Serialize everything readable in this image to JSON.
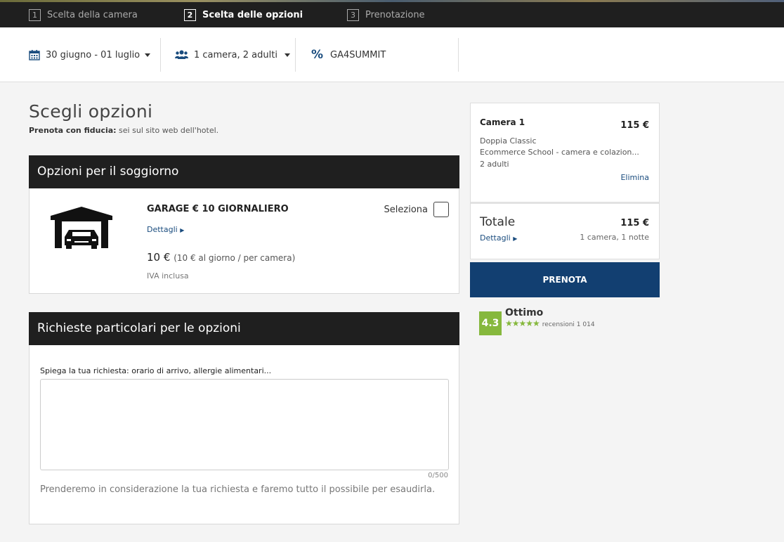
{
  "steps": [
    {
      "num": "1",
      "label": "Scelta della camera"
    },
    {
      "num": "2",
      "label": "Scelta delle opzioni"
    },
    {
      "num": "3",
      "label": "Prenotazione"
    }
  ],
  "filters": {
    "dates": "30 giugno - 01 luglio",
    "guests": "1 camera, 2 adulti",
    "promo_symbol": "%",
    "promo_code": "GA4SUMMIT"
  },
  "main": {
    "title": "Scegli opzioni",
    "trust_bold": "Prenota con fiducia:",
    "trust_text": " sei sul sito web dell'hotel."
  },
  "options_section": {
    "header": "Opzioni per il soggiorno",
    "item": {
      "title": "GARAGE € 10 GIORNALIERO",
      "details": "Dettagli",
      "price": "10 €",
      "price_note": "(10 € al giorno / per camera)",
      "vat": "IVA inclusa",
      "select_label": "Seleziona"
    }
  },
  "requests_section": {
    "header": "Richieste particolari per le opzioni",
    "label": "Spiega la tua richiesta: orario di arrivo, allergie alimentari...",
    "value": "",
    "counter": "0/500",
    "note": "Prenderemo in considerazione la tua richiesta e faremo tutto il possibile per esaudirla."
  },
  "summary": {
    "room": {
      "title": "Camera 1",
      "price": "115 €",
      "type": "Doppia Classic",
      "rate": "Ecommerce School - camera e colazion...",
      "guests": "2 adulti",
      "remove": "Elimina"
    },
    "total": {
      "label": "Totale",
      "price": "115 €",
      "details": "Dettagli",
      "info": "1 camera, 1 notte"
    },
    "book_button": "PRENOTA"
  },
  "rating": {
    "score": "4.3",
    "word": "Ottimo",
    "stars": "★★★★★",
    "count": "recensioni 1 014"
  },
  "colors": {
    "dark_bar": "#1f1f1f",
    "primary_blue": "#123f71",
    "rating_green": "#86b83d"
  }
}
